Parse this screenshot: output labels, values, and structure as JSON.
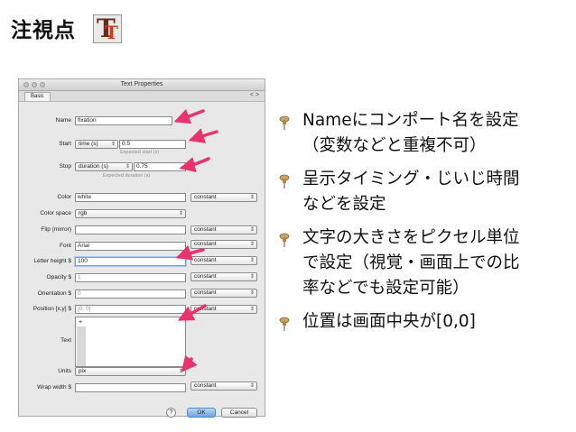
{
  "slide": {
    "title": "注視点"
  },
  "dialog": {
    "window_title": "Text Properties",
    "tab": "Basic",
    "tab_nav": "< >",
    "rows": {
      "name": {
        "label": "Name",
        "value": "fixation"
      },
      "start": {
        "label": "Start",
        "type": "time (s)",
        "value": "0.5",
        "hint": "Expected start (s)"
      },
      "stop": {
        "label": "Stop",
        "type": "duration (s)",
        "value": "0.75",
        "hint": "Expected duration (s)"
      },
      "color": {
        "label": "Color",
        "value": "white",
        "mode": "constant"
      },
      "color_space": {
        "label": "Color space",
        "value": "rgb"
      },
      "flip": {
        "label": "Flip (mirror)",
        "value": "",
        "mode": "constant"
      },
      "font": {
        "label": "Font",
        "value": "Arial",
        "mode": "constant"
      },
      "letter_height": {
        "label": "Letter height $",
        "value": "100",
        "mode": "constant"
      },
      "opacity": {
        "label": "Opacity $",
        "value": "1",
        "mode": "constant"
      },
      "orientation": {
        "label": "Orientation $",
        "value": "0",
        "mode": "constant"
      },
      "position": {
        "label": "Position [x,y] $",
        "value": "[0, 0]",
        "mode": "constant"
      },
      "text": {
        "label": "Text",
        "value": "+"
      },
      "units": {
        "label": "Units",
        "value": "pix"
      },
      "wrap_width": {
        "label": "Wrap width $",
        "value": "",
        "mode": "constant"
      }
    },
    "buttons": {
      "help": "?",
      "ok": "OK",
      "cancel": "Cancel"
    }
  },
  "bullets": [
    {
      "text": "Nameにコンポート名を設定\n（変数などと重複不可）"
    },
    {
      "text": "呈示タイミング・じいじ時間\nなどを設定"
    },
    {
      "text": "文字の大きさをピクセル単位\nで設定（視覚・画面上での比\n率などでも設定可能）"
    },
    {
      "text": "位置は画面中央が[0,0]"
    }
  ],
  "colors": {
    "arrow": "#e8336e",
    "pin": "#b0894a"
  }
}
